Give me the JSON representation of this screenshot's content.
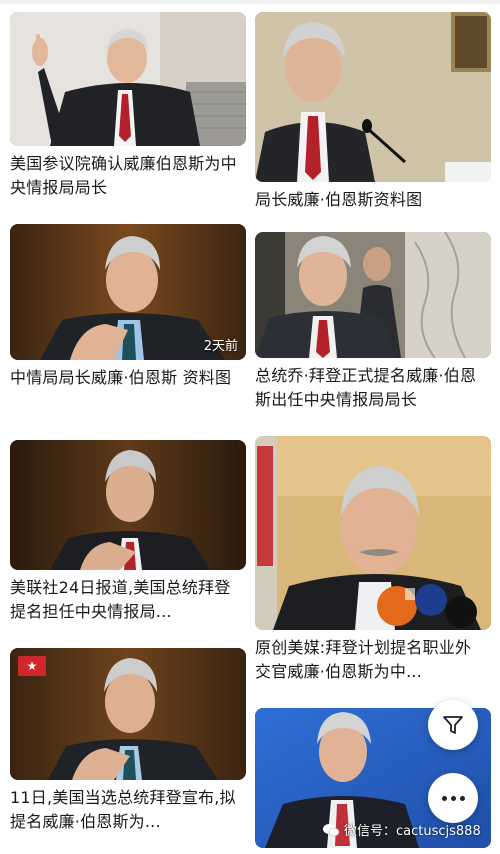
{
  "cards": [
    {
      "caption": "美国参议院确认威廉伯恩斯为中央情报局局长",
      "time": ""
    },
    {
      "caption": "局长威廉·伯恩斯资料图",
      "time": ""
    },
    {
      "caption": "中情局局长威廉·伯恩斯 资料图",
      "time": "2天前"
    },
    {
      "caption": "总统乔·拜登正式提名威廉·伯恩斯出任中央情报局局长",
      "time": ""
    },
    {
      "caption": "美联社24日报道,美国总统拜登提名担任中央情报局...",
      "time": ""
    },
    {
      "caption": "原创美媒:拜登计划提名职业外交官威廉·伯恩斯为中...",
      "time": ""
    },
    {
      "caption": "11日,美国当选总统拜登宣布,拟提名威廉·伯恩斯为...",
      "time": ""
    },
    {
      "caption": "",
      "time": ""
    }
  ],
  "badges": {
    "logo_text": "★"
  },
  "watermark": {
    "text": "微信号：cactuscjs888"
  },
  "icons": {
    "filter": "filter-icon",
    "more": "more-icon",
    "wechat": "wechat-icon"
  },
  "colors": {
    "tie_red": "#b3212b",
    "flag_red": "#c63a3a",
    "blue_bg": "#2a66c9"
  }
}
